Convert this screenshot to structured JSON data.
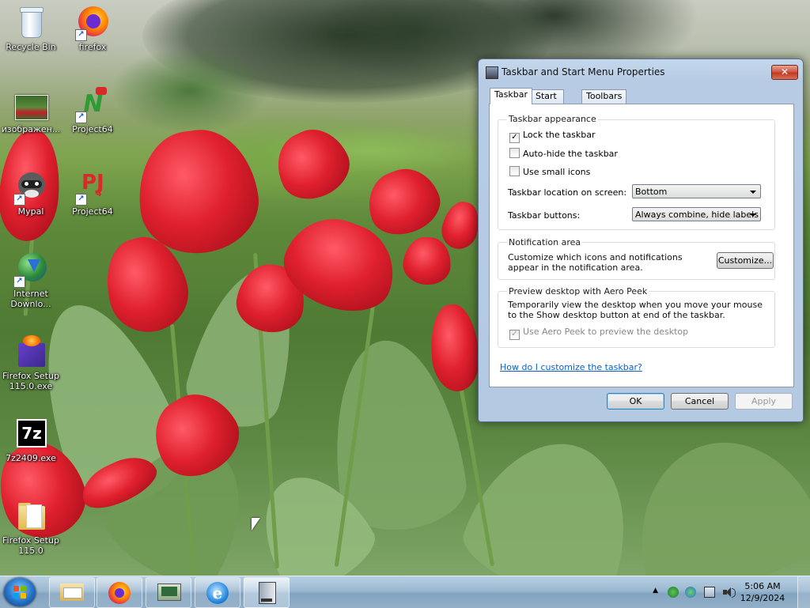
{
  "desktop": {
    "icons": [
      {
        "label": "Recycle Bin"
      },
      {
        "label": "firefox"
      },
      {
        "label": "изображен..."
      },
      {
        "label": "Project64"
      },
      {
        "label": "Mypal"
      },
      {
        "label": "Project64"
      },
      {
        "label": "Internet\nDownlo..."
      },
      {
        "label": "Firefox Setup\n115.0.exe"
      },
      {
        "label": "7z2409.exe"
      },
      {
        "label": "Firefox Setup\n115.0"
      }
    ]
  },
  "dialog": {
    "title": "Taskbar and Start Menu Properties",
    "close_glyph": "✕",
    "tabs": [
      {
        "label": "Taskbar"
      },
      {
        "label": "Start Menu"
      },
      {
        "label": "Toolbars"
      }
    ],
    "appearance": {
      "title": "Taskbar appearance",
      "lock": {
        "label": "Lock the taskbar",
        "checked": true
      },
      "autohide": {
        "label": "Auto-hide the taskbar",
        "checked": false
      },
      "small_icons": {
        "label": "Use small icons",
        "checked": false
      },
      "location_label": "Taskbar location on screen:",
      "location_value": "Bottom",
      "buttons_label": "Taskbar buttons:",
      "buttons_value": "Always combine, hide labels"
    },
    "notification": {
      "title": "Notification area",
      "text": "Customize which icons and notifications appear in the notification area.",
      "button": "Customize..."
    },
    "peek": {
      "title": "Preview desktop with Aero Peek",
      "text": "Temporarily view the desktop when you move your mouse to the Show desktop button at end of the taskbar.",
      "checkbox": {
        "label": "Use Aero Peek to preview the desktop",
        "checked": true,
        "disabled": true
      }
    },
    "help_link": "How do I customize the taskbar?",
    "buttons": {
      "ok": "OK",
      "cancel": "Cancel",
      "apply": "Apply"
    }
  },
  "taskbar": {
    "pinned": [
      "explorer-icon",
      "firefox-icon",
      "network-computer-icon",
      "internet-explorer-icon",
      "taskbar-properties-icon"
    ],
    "tray_arrow": "▲",
    "clock_time": "5:06 AM",
    "clock_date": "12/9/2024"
  }
}
